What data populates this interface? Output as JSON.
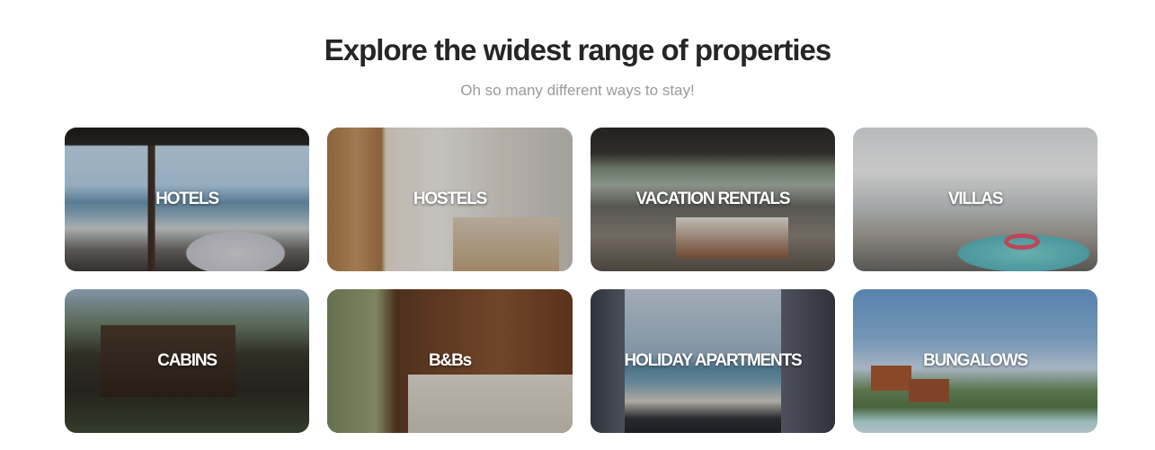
{
  "header": {
    "title": "Explore the widest range of properties",
    "subtitle": "Oh so many different ways to stay!"
  },
  "property_types": [
    {
      "label": "HOTELS",
      "image": "hotel-room-ocean-view"
    },
    {
      "label": "HOSTELS",
      "image": "hostel-bunk-room"
    },
    {
      "label": "VACATION RENTALS",
      "image": "vacation-rental-loft"
    },
    {
      "label": "VILLAS",
      "image": "villa-pool"
    },
    {
      "label": "CABINS",
      "image": "wooden-cabin-forest"
    },
    {
      "label": "B&Bs",
      "image": "bnb-wooden-bedroom"
    },
    {
      "label": "HOLIDAY APARTMENTS",
      "image": "apartment-sea-view"
    },
    {
      "label": "BUNGALOWS",
      "image": "beach-bungalows"
    }
  ]
}
